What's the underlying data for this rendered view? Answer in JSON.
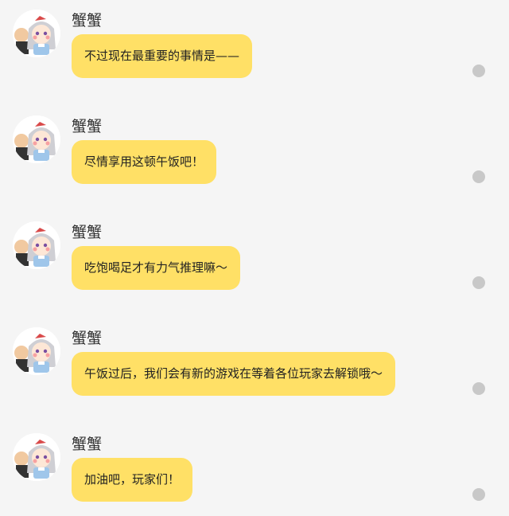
{
  "chat": {
    "messages": [
      {
        "sender": "蟹蟹",
        "text": "不过现在最重要的事情是——",
        "avatar_icon": "character-avatar-icon"
      },
      {
        "sender": "蟹蟹",
        "text": "尽情享用这顿午饭吧！",
        "avatar_icon": "character-avatar-icon"
      },
      {
        "sender": "蟹蟹",
        "text": "吃饱喝足才有力气推理嘛～",
        "avatar_icon": "character-avatar-icon"
      },
      {
        "sender": "蟹蟹",
        "text": "午饭过后，我们会有新的游戏在等着各位玩家去解锁哦～",
        "avatar_icon": "character-avatar-icon"
      },
      {
        "sender": "蟹蟹",
        "text": "加油吧，玩家们！",
        "avatar_icon": "character-avatar-icon"
      }
    ]
  },
  "colors": {
    "background": "#f5f5f5",
    "bubble": "#ffe066",
    "status_dot": "#c8c8c8"
  }
}
